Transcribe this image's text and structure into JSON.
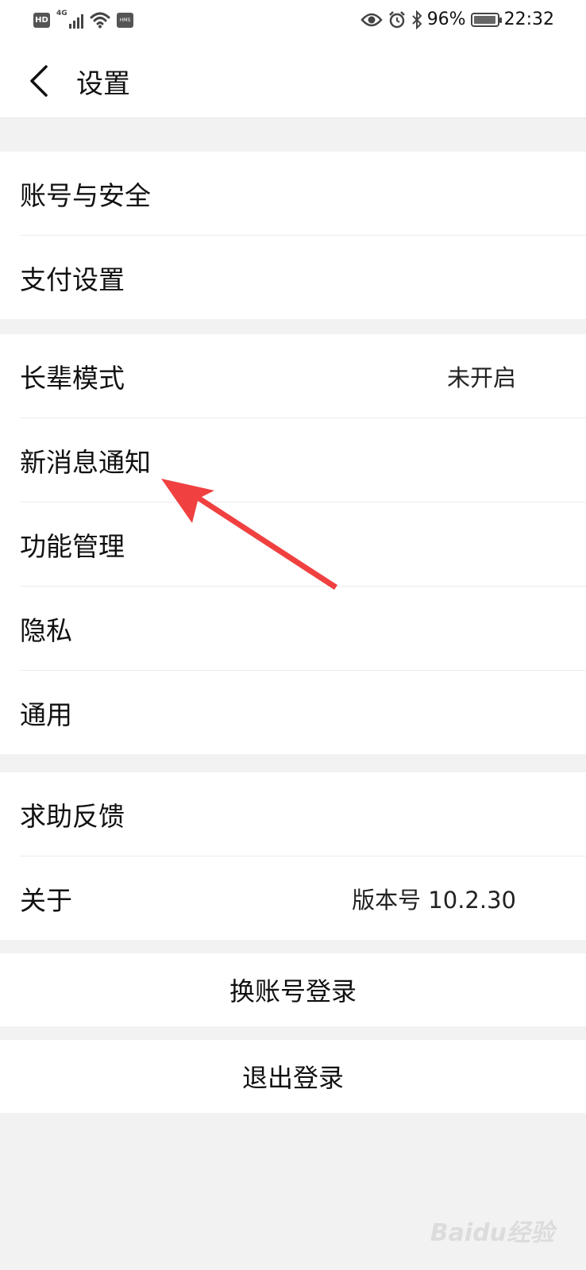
{
  "status_bar": {
    "hd": "HD",
    "network": "4G",
    "hms": "HMS",
    "battery": "96%",
    "battery_level": 0.96,
    "time": "22:32"
  },
  "header": {
    "title": "设置"
  },
  "groups": [
    {
      "items": [
        {
          "label": "账号与安全"
        },
        {
          "label": "支付设置"
        }
      ]
    },
    {
      "items": [
        {
          "label": "长辈模式",
          "value": "未开启"
        },
        {
          "label": "新消息通知"
        },
        {
          "label": "功能管理"
        },
        {
          "label": "隐私"
        },
        {
          "label": "通用"
        }
      ]
    },
    {
      "items": [
        {
          "label": "求助反馈"
        },
        {
          "label": "关于",
          "value": "版本号 10.2.30"
        }
      ]
    }
  ],
  "actions": {
    "switch_account": "换账号登录",
    "logout": "退出登录"
  },
  "annotation": {
    "color": "#f04040"
  },
  "watermark": "Baidu经验"
}
